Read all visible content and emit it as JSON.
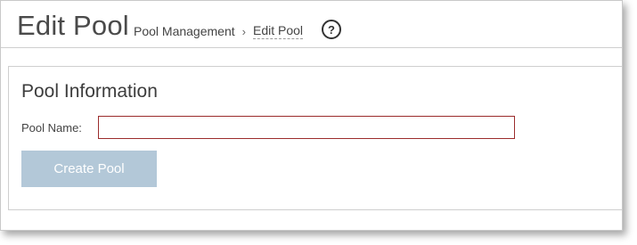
{
  "header": {
    "title": "Edit Pool",
    "breadcrumb": {
      "parent": "Pool Management",
      "separator": "›",
      "current": "Edit Pool"
    },
    "help_icon": "?"
  },
  "panel": {
    "title": "Pool Information",
    "pool_name_label": "Pool Name:",
    "pool_name_value": "",
    "create_button_label": "Create Pool"
  },
  "colors": {
    "input_border_invalid": "#9b2c2c",
    "button_disabled_bg": "#b3c8d8"
  }
}
